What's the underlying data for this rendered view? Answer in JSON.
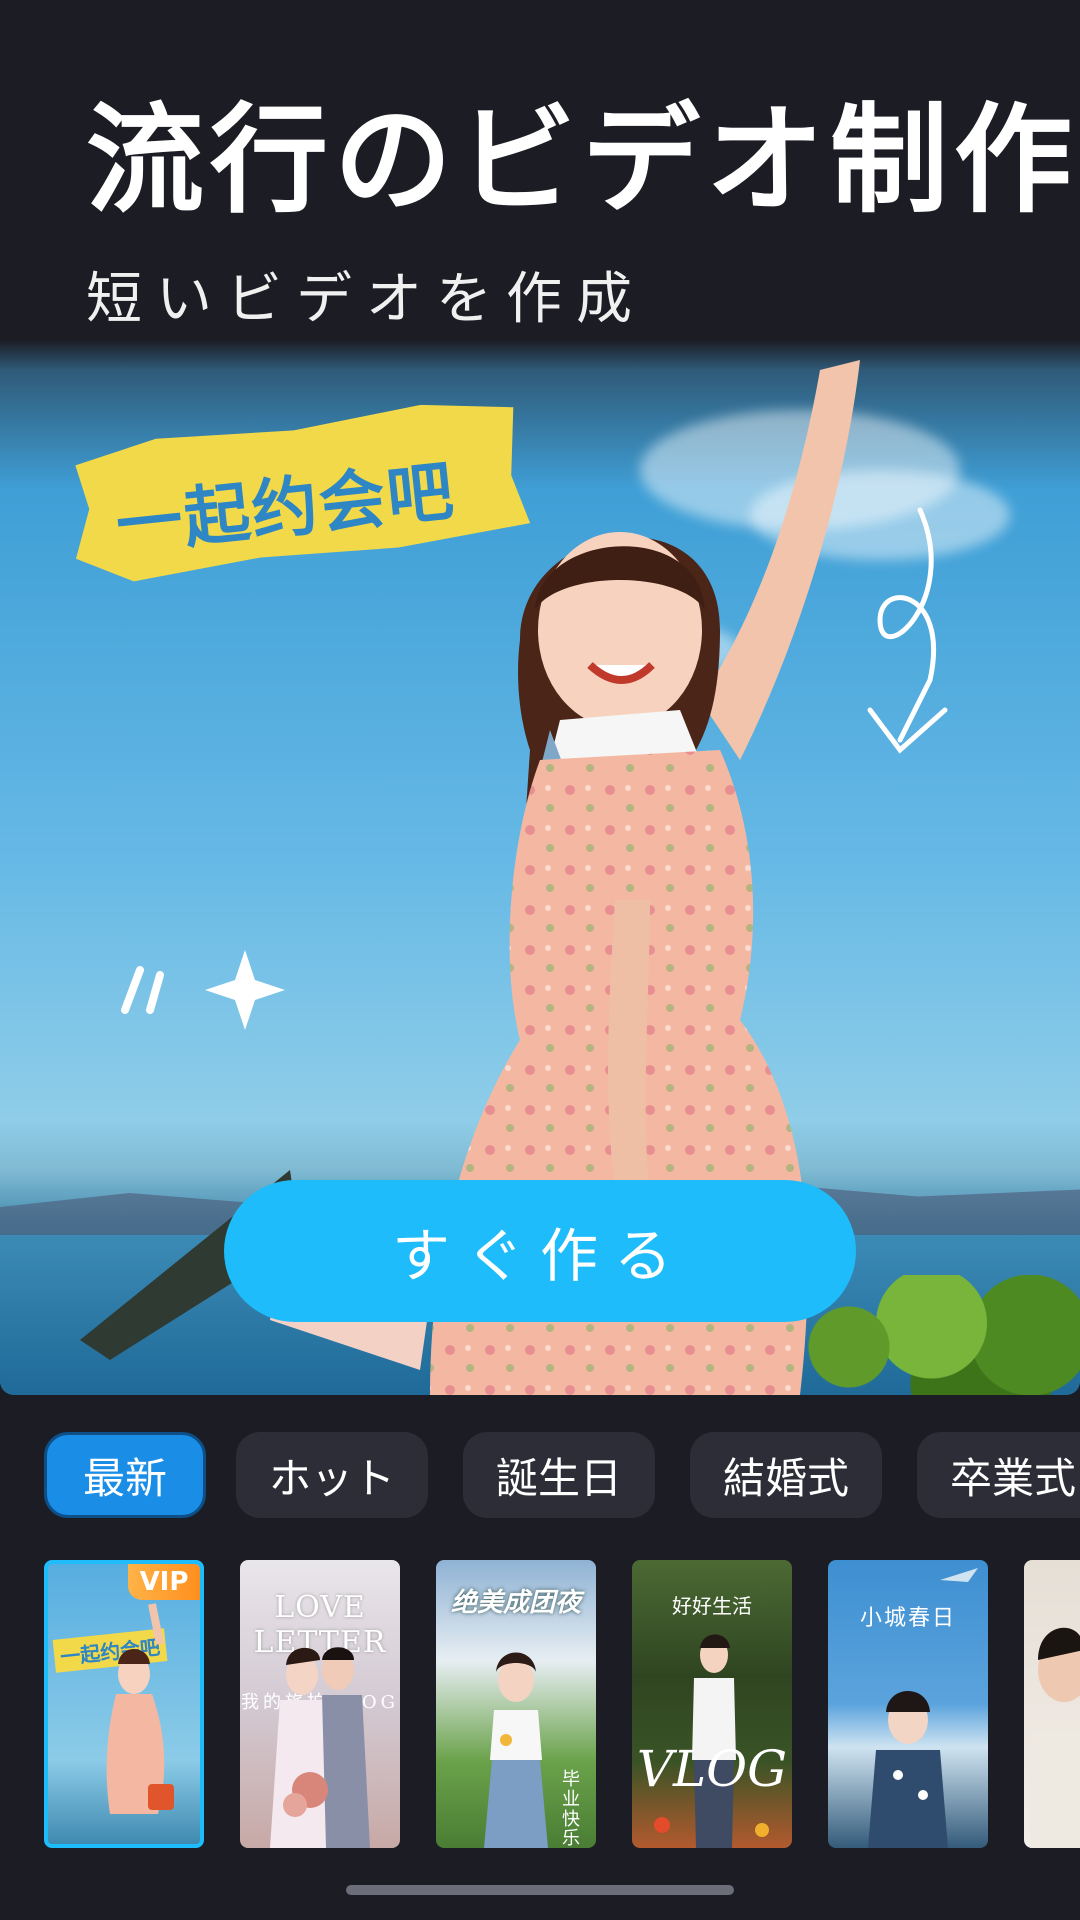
{
  "header": {
    "title": "流行のビデオ制作",
    "subtitle": "短いビデオを作成"
  },
  "hero": {
    "sticker_text": "一起约会吧"
  },
  "cta": {
    "label": "すぐ作る"
  },
  "tabs": [
    {
      "label": "最新",
      "active": true
    },
    {
      "label": "ホット",
      "active": false
    },
    {
      "label": "誕生日",
      "active": false
    },
    {
      "label": "結婚式",
      "active": false
    },
    {
      "label": "卒業式",
      "active": false
    }
  ],
  "thumbnails": [
    {
      "badge": "VIP",
      "text": "一起约会吧"
    },
    {
      "text": "LOVE LETTER",
      "caption": "我的旅拍VLOG"
    },
    {
      "text": "绝美成团夜",
      "caption": "毕业快乐"
    },
    {
      "text": "好好生活",
      "caption": "VLOG"
    },
    {
      "text": "小城春日"
    },
    {
      "text": ""
    }
  ],
  "colors": {
    "background": "#1c1d24",
    "accent": "#1ebcfb",
    "active_tab": "#1a8de6",
    "tab": "#2c2d36",
    "vip": "#ff9f2e"
  }
}
